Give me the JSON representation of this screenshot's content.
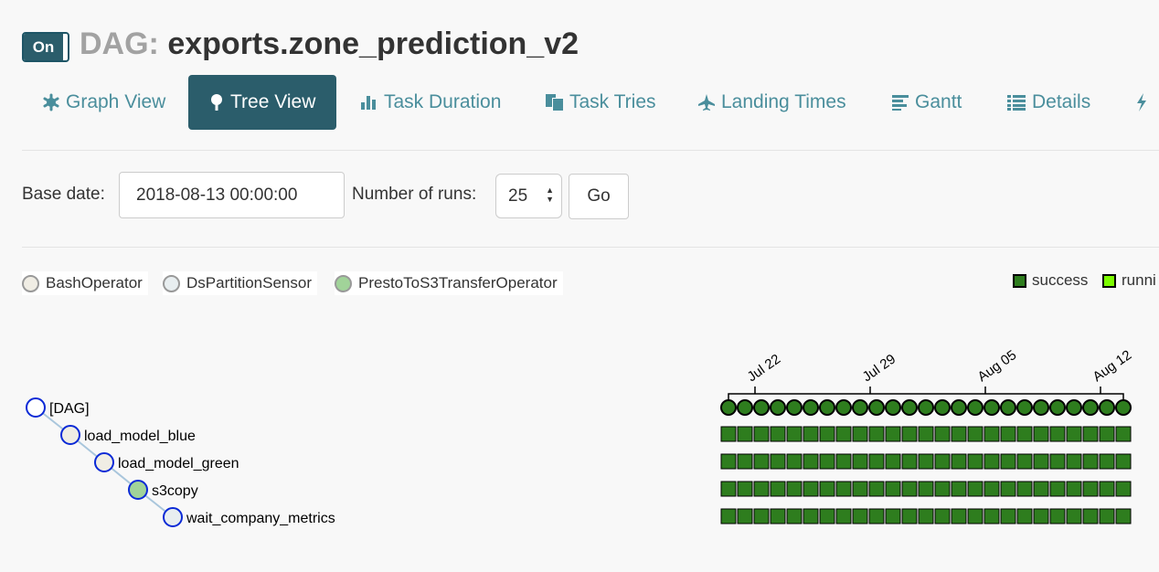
{
  "header": {
    "toggle_label": "On",
    "title_prefix": "DAG:",
    "dag_id": "exports.zone_prediction_v2"
  },
  "nav": {
    "items": [
      {
        "label": "Graph View",
        "icon": "asterisk-icon"
      },
      {
        "label": "Tree View",
        "icon": "tree-icon",
        "active": true
      },
      {
        "label": "Task Duration",
        "icon": "bar-chart-icon"
      },
      {
        "label": "Task Tries",
        "icon": "duplicate-icon"
      },
      {
        "label": "Landing Times",
        "icon": "plane-icon"
      },
      {
        "label": "Gantt",
        "icon": "align-left-icon"
      },
      {
        "label": "Details",
        "icon": "list-icon"
      },
      {
        "label": "",
        "icon": "flash-icon"
      }
    ]
  },
  "form": {
    "base_date_label": "Base date:",
    "base_date_value": "2018-08-13 00:00:00",
    "num_runs_label": "Number of runs:",
    "num_runs_value": "25",
    "go_label": "Go"
  },
  "operator_legend": [
    {
      "label": "BashOperator",
      "color": "#f0ede4"
    },
    {
      "label": "DsPartitionSensor",
      "color": "#e8eef0"
    },
    {
      "label": "PrestoToS3TransferOperator",
      "color": "#a1d399"
    }
  ],
  "state_legend": [
    {
      "label": "success",
      "color": "#2e7d1e"
    },
    {
      "label": "runni",
      "color": "#7cfc00"
    }
  ],
  "tree": {
    "nodes": [
      {
        "label": "[DAG]",
        "fill": "#ffffff",
        "depth": 0
      },
      {
        "label": "load_model_blue",
        "fill": "#f0ede4",
        "depth": 1
      },
      {
        "label": "load_model_green",
        "fill": "#f0ede4",
        "depth": 2
      },
      {
        "label": "s3copy",
        "fill": "#a1d399",
        "depth": 3
      },
      {
        "label": "wait_company_metrics",
        "fill": "#e8eef0",
        "depth": 4
      }
    ],
    "date_ticks": [
      "Jul 22",
      "Jul 29",
      "Aug 05",
      "Aug 12"
    ],
    "run_count": 25,
    "task_instance_state": "success",
    "dag_run_state": "success"
  },
  "colors": {
    "accent": "#2b5d6b",
    "nav_link": "#4a8e9c",
    "success": "#2e7d1e",
    "node_stroke": "#0b2ad6"
  }
}
